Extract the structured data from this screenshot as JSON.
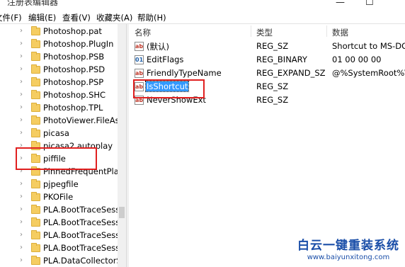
{
  "window": {
    "title": "注册表编辑器",
    "minimize_glyph": "—",
    "maximize_glyph": "☐"
  },
  "menu": [
    "文件(F)",
    "编辑(E)",
    "查看(V)",
    "收藏夹(A)",
    "帮助(H)"
  ],
  "tree": {
    "items": [
      "Photoshop.pat",
      "Photoshop.PlugIn",
      "Photoshop.PSB",
      "Photoshop.PSD",
      "Photoshop.PSP",
      "Photoshop.SHC",
      "Photoshop.TPL",
      "PhotoViewer.FileAss",
      "picasa",
      "picasa2.autoplay",
      "piffile",
      "PinnedFrequentPlac",
      "pjpegfile",
      "PKOFile",
      "PLA.BootTraceSessi",
      "PLA.BootTraceSessi",
      "PLA.BootTraceSessi",
      "PLA.BootTraceSessi",
      "PLA.DataCollectorSe"
    ],
    "selected": "piffile",
    "expand_glyph": "›"
  },
  "list": {
    "columns": {
      "name": "名称",
      "type": "类型",
      "data": "数据"
    },
    "rows": [
      {
        "name": "(默认)",
        "type": "REG_SZ",
        "data": "Shortcut to MS-DOS",
        "icon": "string-value-icon"
      },
      {
        "name": "EditFlags",
        "type": "REG_BINARY",
        "data": "01 00 00 00",
        "icon": "binary-value-icon"
      },
      {
        "name": "FriendlyTypeName",
        "type": "REG_EXPAND_SZ",
        "data": "@%SystemRoot%\\S",
        "icon": "string-value-icon"
      },
      {
        "name": "IsShortcut",
        "type": "REG_SZ",
        "data": "",
        "icon": "string-value-icon"
      },
      {
        "name": "NeverShowExt",
        "type": "REG_SZ",
        "data": "",
        "icon": "string-value-icon"
      }
    ],
    "selected": "IsShortcut"
  },
  "watermark": {
    "text": "白云一键重装系统",
    "url": "www.baiyunxitong.com"
  },
  "colors": {
    "highlight_box": "#e02020",
    "selection": "#3399ff",
    "folder": "#f5cd61",
    "watermark": "#1a4ea8"
  }
}
